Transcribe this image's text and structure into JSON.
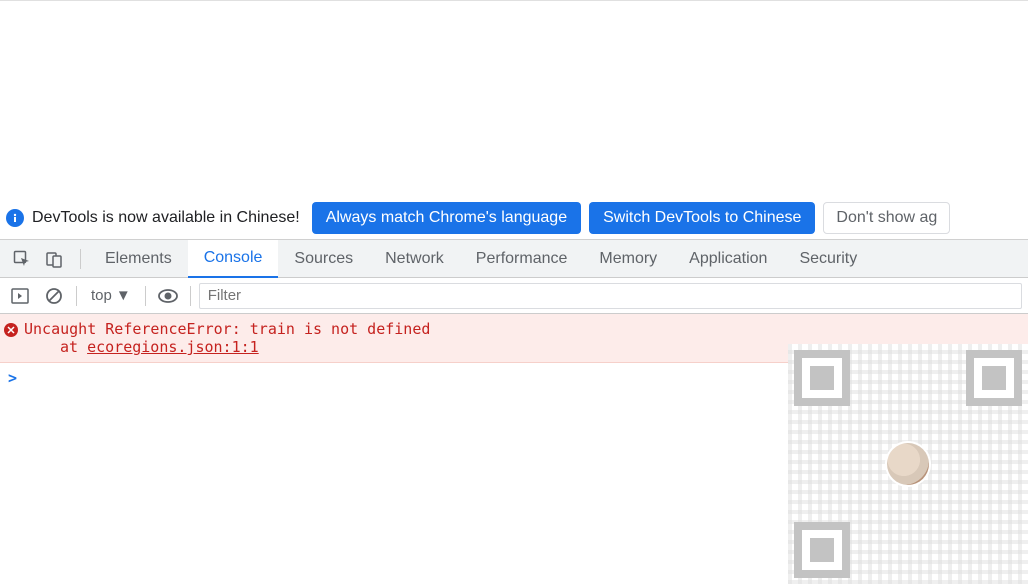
{
  "infobar": {
    "message": "DevTools is now available in Chinese!",
    "match_button": "Always match Chrome's language",
    "switch_button": "Switch DevTools to Chinese",
    "dismiss_button": "Don't show ag"
  },
  "tabs": {
    "elements": "Elements",
    "console": "Console",
    "sources": "Sources",
    "network": "Network",
    "performance": "Performance",
    "memory": "Memory",
    "application": "Application",
    "security": "Security"
  },
  "toolbar": {
    "context": "top",
    "filter_placeholder": "Filter"
  },
  "console": {
    "error_text": "Uncaught ReferenceError: train is not defined",
    "error_at": "at ",
    "error_link": "ecoregions.json:1:1",
    "prompt": ">"
  }
}
